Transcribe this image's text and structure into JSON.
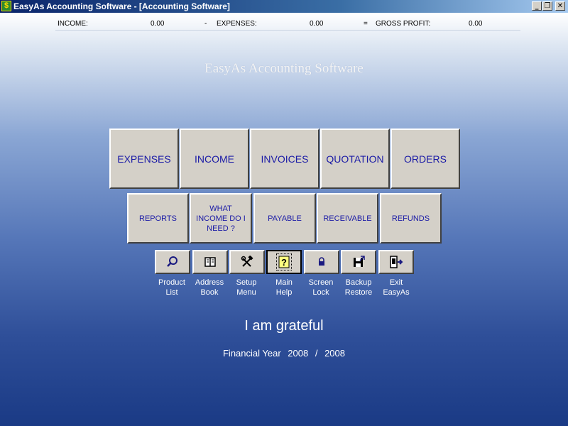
{
  "window": {
    "title": "EasyAs Accounting Software - [Accounting Software]",
    "app_icon_glyph": "$",
    "controls": {
      "minimize": "_",
      "restore": "❐",
      "close": "✕"
    }
  },
  "summary": {
    "income_label": "INCOME:",
    "income_value": "0.00",
    "minus": "-",
    "expenses_label": "EXPENSES:",
    "expenses_value": "0.00",
    "equals": "=",
    "gross_profit_label": "GROSS PROFIT:",
    "gross_profit_value": "0.00"
  },
  "heading": "EasyAs Accounting Software",
  "main_buttons": [
    "EXPENSES",
    "INCOME",
    "INVOICES",
    "QUOTATION",
    "ORDERS"
  ],
  "secondary_buttons": [
    "REPORTS",
    "WHAT INCOME DO I NEED ?",
    "PAYABLE",
    "RECEIVABLE",
    "REFUNDS"
  ],
  "tools": [
    {
      "icon": "magnifier-icon",
      "label": "Product\nList"
    },
    {
      "icon": "address-book-icon",
      "label": "Address\nBook"
    },
    {
      "icon": "tools-icon",
      "label": "Setup\nMenu"
    },
    {
      "icon": "help-icon",
      "label": "Main\nHelp"
    },
    {
      "icon": "lock-icon",
      "label": "Screen\nLock"
    },
    {
      "icon": "floppy-disk-icon",
      "label": "Backup\nRestore"
    },
    {
      "icon": "exit-door-icon",
      "label": "Exit\nEasyAs"
    }
  ],
  "tagline": "I am grateful",
  "financial_year": {
    "label": "Financial Year",
    "start": "2008",
    "separator": "/",
    "end": "2008"
  },
  "colors": {
    "button_face": "#d4d0c8",
    "button_text": "#1a1aa6",
    "titlebar": "#0a246a"
  }
}
